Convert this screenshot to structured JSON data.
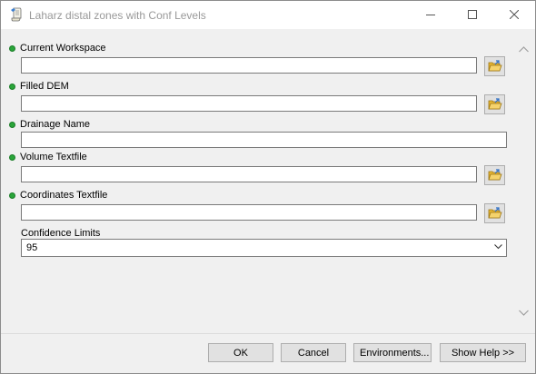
{
  "window": {
    "title": "Laharz distal zones with Conf Levels"
  },
  "parameters": [
    {
      "label": "Current Workspace",
      "value": ""
    },
    {
      "label": "Filled DEM",
      "value": ""
    },
    {
      "label": "Drainage Name",
      "value": ""
    },
    {
      "label": "Volume Textfile",
      "value": ""
    },
    {
      "label": "Coordinates Textfile",
      "value": ""
    }
  ],
  "confidence": {
    "label": "Confidence Limits",
    "value": "95"
  },
  "buttons": {
    "ok": "OK",
    "cancel": "Cancel",
    "environments": "Environments...",
    "show_help": "Show Help >>"
  },
  "icons": {
    "app": "script-tool-icon",
    "browse": "open-folder-icon",
    "required": "required-dot-icon"
  },
  "colors": {
    "required_dot": "#2aa53a",
    "folder": "#e8b732"
  }
}
